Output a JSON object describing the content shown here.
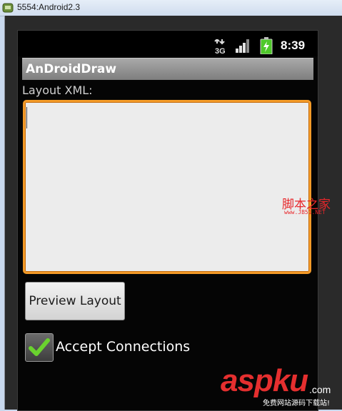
{
  "window": {
    "title": "5554:Android2.3"
  },
  "statusbar": {
    "network": "3G",
    "time": "8:39"
  },
  "app": {
    "title": "AnDroidDraw",
    "layout_label": "Layout XML:",
    "layout_xml_value": "",
    "preview_button": "Preview Layout",
    "accept_connections": {
      "label": "Accept Connections",
      "checked": true
    }
  },
  "watermarks": {
    "jb51_text": "脚本之家",
    "jb51_url": "www.JB51.NET",
    "aspku_text": "aspku",
    "aspku_domain": ".com",
    "aspku_sub": "免费网站源码下载站!"
  },
  "colors": {
    "focus_border": "#f39a28",
    "check_green": "#6ad22e",
    "battery_green": "#4fc92a",
    "watermark_red": "#e52f2f"
  }
}
